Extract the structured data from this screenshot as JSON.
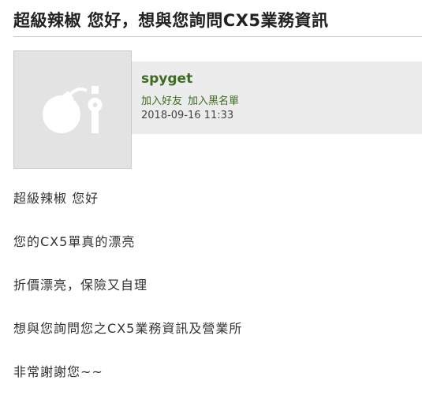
{
  "message": {
    "subject": "超級辣椒 您好，想與您詢問CX5業務資訊",
    "sender": {
      "username": "spyget",
      "avatar_icon": "bomb-icon",
      "actions": {
        "add_friend": "加入好友",
        "add_blacklist": "加入黑名單"
      },
      "timestamp": "2018-09-16 11:33"
    },
    "body_lines": [
      "超級辣椒 您好",
      "您的CX5單真的漂亮",
      "折價漂亮，保險又自理",
      "想與您詢問您之CX5業務資訊及營業所",
      "非常謝謝您~~"
    ]
  },
  "colors": {
    "link_green": "#3d6b21",
    "band_gray": "#ececec",
    "avatar_gray": "#e3e3e3"
  }
}
